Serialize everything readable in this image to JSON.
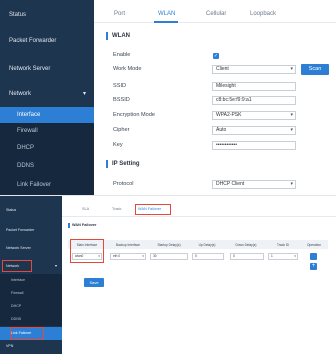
{
  "panel1": {
    "sidebar": {
      "items": [
        {
          "label": "Status"
        },
        {
          "label": "Packet Forwarder"
        },
        {
          "label": "Network Server"
        },
        {
          "label": "Network"
        },
        {
          "label": "Interface"
        },
        {
          "label": "Firewall"
        },
        {
          "label": "DHCP"
        },
        {
          "label": "DDNS"
        },
        {
          "label": "Link Failover"
        }
      ]
    },
    "tabs": [
      "Port",
      "WLAN",
      "Cellular",
      "Loopback"
    ],
    "wlan_section": "WLAN",
    "form": {
      "enable_label": "Enable",
      "work_mode_label": "Work Mode",
      "work_mode_value": "Client",
      "scan_button": "Scan",
      "ssid_label": "SSID",
      "ssid_value": "Milesight",
      "bssid_label": "BSSID",
      "bssid_value": "c8:bc:5e:f9:9:a1",
      "encryption_label": "Encryption Mode",
      "encryption_value": "WPA2-PSK",
      "cipher_label": "Cipher",
      "cipher_value": "Auto",
      "key_label": "Key",
      "key_value": "••••••••••••"
    },
    "ip_section": "IP Setting",
    "protocol_label": "Protocol",
    "protocol_value": "DHCP Client"
  },
  "panel2": {
    "sidebar": {
      "items": [
        {
          "label": "Status"
        },
        {
          "label": "Packet Forwarder"
        },
        {
          "label": "Network Server"
        },
        {
          "label": "Network"
        },
        {
          "label": "Interface"
        },
        {
          "label": "Firewall"
        },
        {
          "label": "DHCP"
        },
        {
          "label": "DDNS"
        },
        {
          "label": "Link Failover"
        },
        {
          "label": "VPN"
        }
      ]
    },
    "tabs": [
      "SLA",
      "Track",
      "WAN Failover"
    ],
    "section": "WAN Failover",
    "table": {
      "headers": [
        "Main Interface",
        "Backup Interface",
        "Startup Delay(s)",
        "Up Delay(s)",
        "Down Delay(s)",
        "Track ID",
        "Operation"
      ],
      "row": {
        "main_interface": "wlan0",
        "backup_interface": "eth 0",
        "startup_delay": "30",
        "up_delay": "0",
        "down_delay": "0",
        "track_id": "1"
      }
    },
    "save_button": "Save"
  },
  "colors": {
    "sidebar_bg": "#1e3550",
    "accent": "#2c7fd4",
    "highlight": "#e24b3c"
  }
}
